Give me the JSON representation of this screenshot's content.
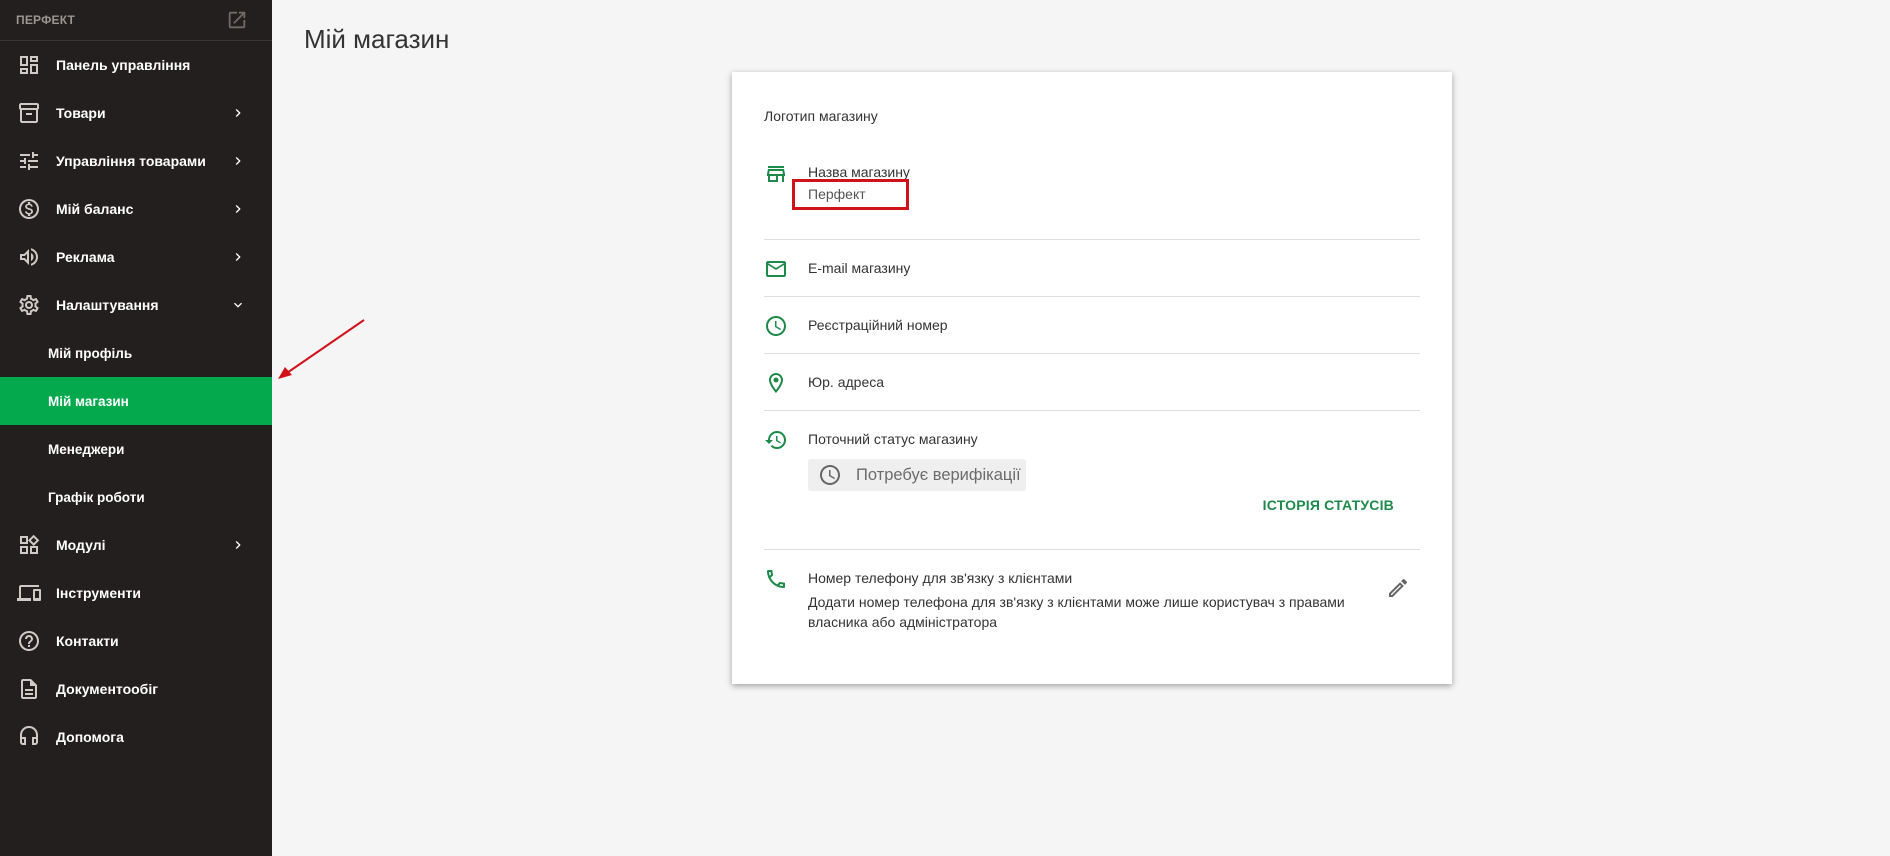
{
  "sidebar": {
    "brand": "ПЕРФЕКТ",
    "items": [
      {
        "label": "Панель управління",
        "icon": "dashboard-icon",
        "has_children": false
      },
      {
        "label": "Товари",
        "icon": "archive-box-icon",
        "has_children": true
      },
      {
        "label": "Управління товарами",
        "icon": "sliders-icon",
        "has_children": true
      },
      {
        "label": "Мій баланс",
        "icon": "dollar-coin-icon",
        "has_children": true
      },
      {
        "label": "Реклама",
        "icon": "megaphone-icon",
        "has_children": true
      },
      {
        "label": "Налаштування",
        "icon": "gear-icon",
        "has_children": true,
        "expanded": true
      }
    ],
    "sub_items": [
      {
        "label": "Мій профіль",
        "active": false
      },
      {
        "label": "Мій магазин",
        "active": true
      },
      {
        "label": "Менеджери",
        "active": false
      },
      {
        "label": "Графік роботи",
        "active": false
      }
    ],
    "items_after": [
      {
        "label": "Модулі",
        "icon": "widgets-icon",
        "has_children": true
      },
      {
        "label": "Інструменти",
        "icon": "devices-icon",
        "has_children": false
      },
      {
        "label": "Контакти",
        "icon": "help-circle-icon",
        "has_children": false
      },
      {
        "label": "Документообіг",
        "icon": "document-icon",
        "has_children": false
      },
      {
        "label": "Допомога",
        "icon": "headset-icon",
        "has_children": false
      }
    ]
  },
  "main": {
    "title": "Мій магазин",
    "card": {
      "logo_label": "Логотип магазину",
      "shop_name_label": "Назва магазину",
      "shop_name_value": "Перфект",
      "email_label": "E-mail магазину",
      "reg_number_label": "Реєстраційний номер",
      "address_label": "Юр. адреса",
      "status_label": "Поточний статус магазину",
      "status_value": "Потребує верифікації",
      "history_button": "ІСТОРІЯ СТАТУСІВ",
      "phone_label": "Номер телефону для зв'язку з клієнтами",
      "phone_note": "Додати номер телефона для зв'язку з клієнтами може лише користувач з правами власника або адміністратора"
    }
  },
  "colors": {
    "sidebar_bg": "#231f1e",
    "active_green": "#04a94d",
    "accent_green": "#1e8a4a",
    "highlight_red": "#d0121b"
  }
}
